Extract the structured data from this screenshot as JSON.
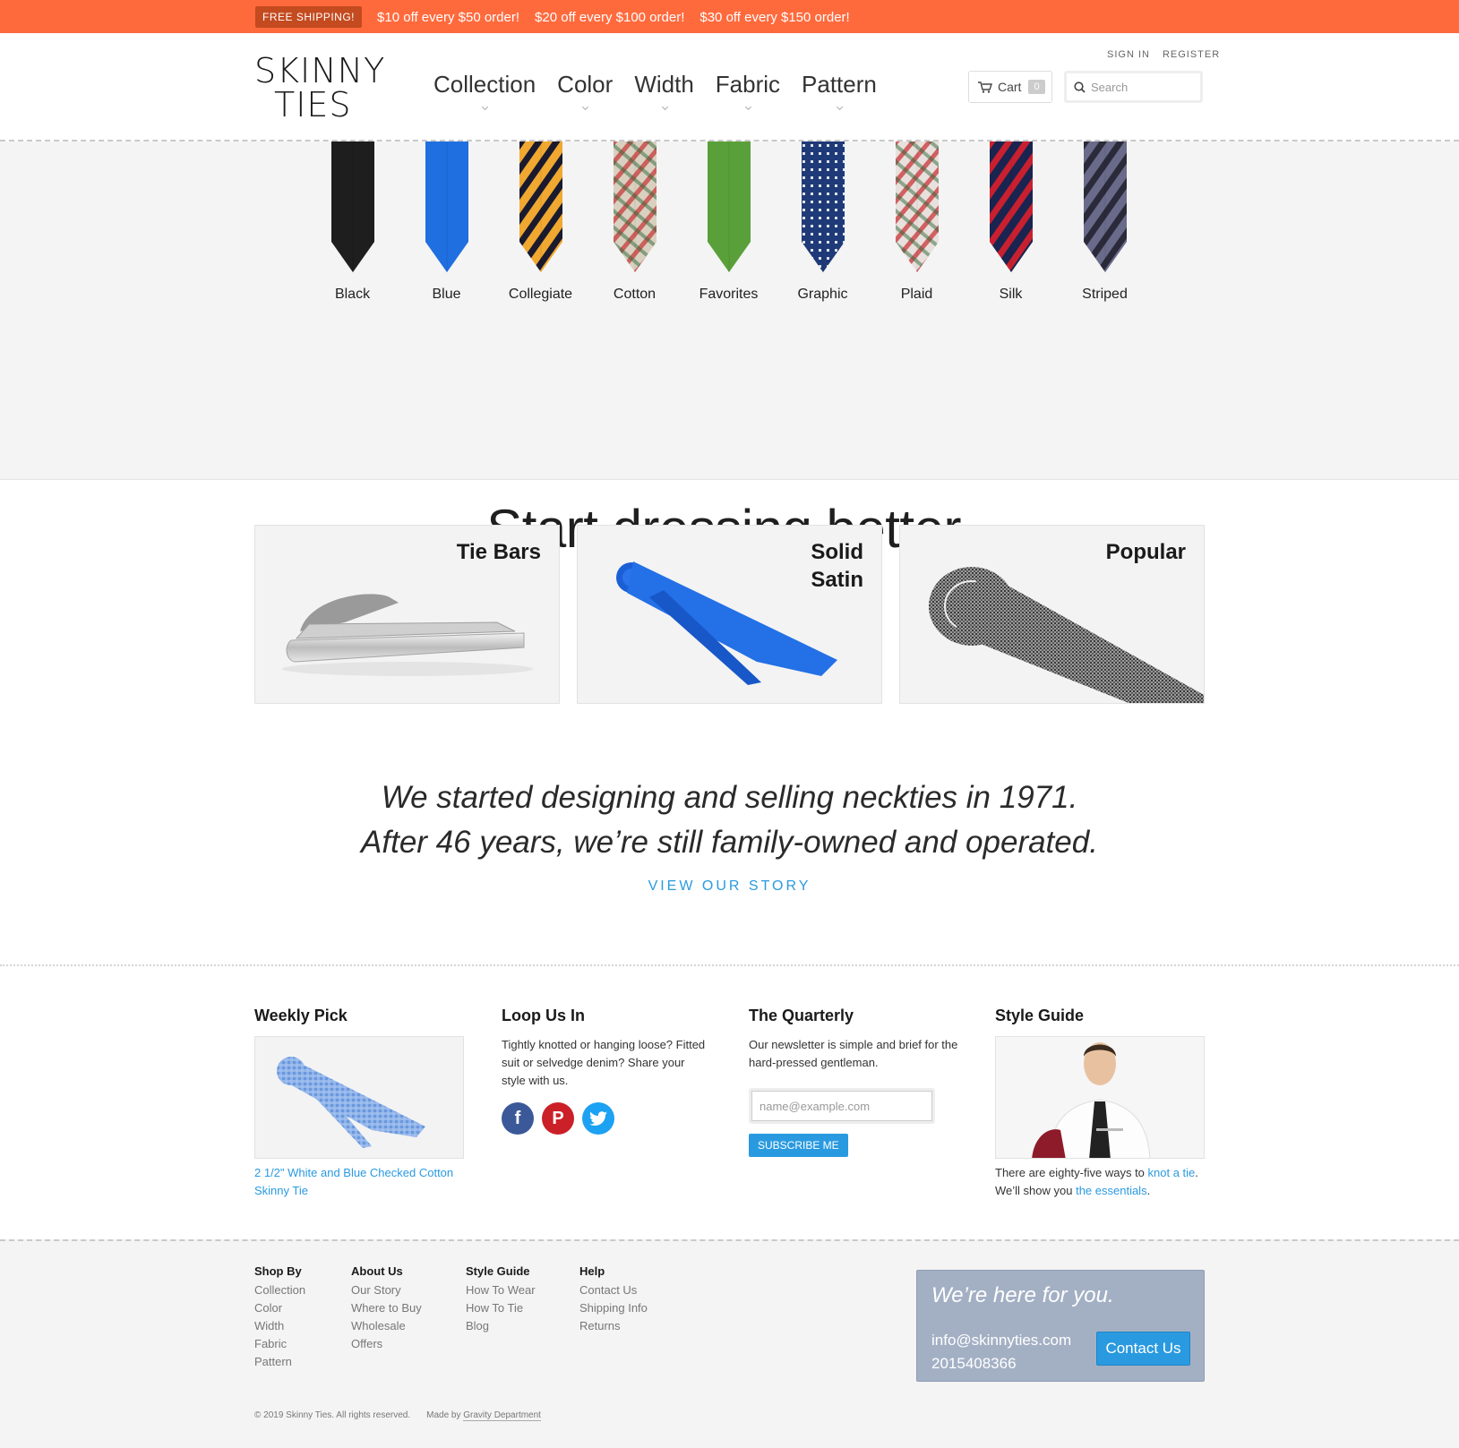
{
  "promo": {
    "badge": "FREE SHIPPING!",
    "offers": [
      "$10 off every $50 order!",
      "$20 off every $100 order!",
      "$30 off every $150 order!"
    ],
    "background": "#ff6a3d"
  },
  "header": {
    "logo_line1": "SKINNY",
    "logo_line2": "TIES",
    "nav": [
      "Collection",
      "Color",
      "Width",
      "Fabric",
      "Pattern"
    ],
    "sign_in": "SIGN IN",
    "register": "REGISTER",
    "cart_label": "Cart",
    "cart_count": "0",
    "search_placeholder": "Search"
  },
  "tie_categories": [
    {
      "label": "Black",
      "color": "#1e1e1e"
    },
    {
      "label": "Blue",
      "color": "#1f6fe0"
    },
    {
      "label": "Collegiate",
      "color": "#f0a830"
    },
    {
      "label": "Cotton",
      "color": "#d9d0c0"
    },
    {
      "label": "Favorites",
      "color": "#5aa03a"
    },
    {
      "label": "Graphic",
      "color": "#1f3a78"
    },
    {
      "label": "Plaid",
      "color": "#e8e0dc"
    },
    {
      "label": "Silk",
      "color": "#1a2450"
    },
    {
      "label": "Striped",
      "color": "#6a6a8a"
    }
  ],
  "hero": {
    "title": "Start dressing better."
  },
  "cards": [
    {
      "title_line1": "Tie Bars",
      "title_line2": ""
    },
    {
      "title_line1": "Solid",
      "title_line2": "Satin"
    },
    {
      "title_line1": "Popular",
      "title_line2": ""
    }
  ],
  "story": {
    "line1": "We started designing and selling neckties in 1971.",
    "line2": "After 46 years, we’re still family-owned and operated.",
    "link": "VIEW OUR STORY"
  },
  "widgets": {
    "weekly_pick": {
      "title": "Weekly Pick",
      "caption": "2 1/2\" White and Blue Checked Cotton Skinny Tie"
    },
    "loop": {
      "title": "Loop Us In",
      "text": "Tightly knotted or hanging loose? Fitted suit or selvedge denim? Share your style with us.",
      "social": [
        "facebook-icon",
        "pinterest-icon",
        "twitter-icon"
      ]
    },
    "quarterly": {
      "title": "The Quarterly",
      "text": "Our newsletter is simple and brief for the hard-pressed gentleman.",
      "placeholder": "name@example.com",
      "button": "SUBSCRIBE ME"
    },
    "style_guide": {
      "title": "Style Guide",
      "text1": "There are eighty-five ways to ",
      "link1": "knot a tie",
      "text2": ". We’ll show you ",
      "link2": "the essentials",
      "text3": "."
    }
  },
  "footer": {
    "columns": [
      {
        "title": "Shop By",
        "items": [
          "Collection",
          "Color",
          "Width",
          "Fabric",
          "Pattern"
        ]
      },
      {
        "title": "About Us",
        "items": [
          "Our Story",
          "Where to Buy",
          "Wholesale",
          "Offers"
        ]
      },
      {
        "title": "Style Guide",
        "items": [
          "How To Wear",
          "How To Tie",
          "Blog"
        ]
      },
      {
        "title": "Help",
        "items": [
          "Contact Us",
          "Shipping Info",
          "Returns"
        ]
      }
    ],
    "help_box": {
      "title": "We’re here for you.",
      "email": "info@skinnyties.com",
      "phone": "2015408366",
      "button": "Contact Us"
    },
    "copyright": "© 2019 Skinny Ties. All rights reserved.",
    "made_by_prefix": "Made by ",
    "made_by_link": "Gravity Department"
  },
  "colors": {
    "accent": "#2a9ae0",
    "promo": "#ff6a3d",
    "help_box": "#a3b0c4"
  }
}
